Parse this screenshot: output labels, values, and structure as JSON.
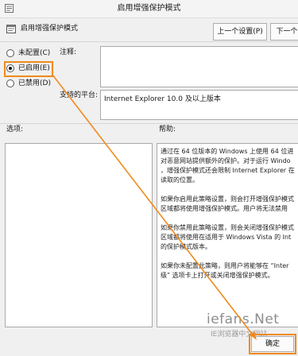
{
  "window": {
    "title": "启用增强保护模式"
  },
  "policy": {
    "name": "启用增强保护模式"
  },
  "nav": {
    "prev_label": "上一个设置(P)",
    "next_label": "下一个"
  },
  "options": [
    {
      "label": "未配置(C)",
      "selected": false
    },
    {
      "label": "已启用(E)",
      "selected": true
    },
    {
      "label": "已禁用(D)",
      "selected": false
    }
  ],
  "comment": {
    "label": "注释:",
    "value": ""
  },
  "platform": {
    "label": "支持的平台:",
    "value": "Internet Explorer 10.0 及以上版本"
  },
  "sections": {
    "options_label": "选项:",
    "help_label": "帮助:"
  },
  "help": {
    "paragraphs": [
      "通过在 64 位版本的 Windows 上使用 64 位进\n对恶意网站提供额外的保护。对于运行 Windo\n，增强保护模式还会限制 Internet Explorer 在\n读取的位置。",
      "如果你启用此策略设置，则会打开增强保护模式\n区域都将使用增强保护模式。用户将无法禁用",
      "如果你禁用此策略设置，则会关闭增强保护模式\n区域都将使用在适用于 Windows Vista 的 Int\n的保护模式版本。",
      "如果你未配置此策略，则用户将能够在 “Inter\n级” 选项卡上打开或关闭增强保护模式。"
    ]
  },
  "footer": {
    "ok_label": "确定"
  },
  "watermark": {
    "brand": "iefans.Net",
    "sub": "IE浏览器中文网站"
  },
  "colors": {
    "highlight": "#ef8a1e",
    "window_bg": "#f0f0f0"
  },
  "icons": {
    "window": "policy-window-icon",
    "policy": "policy-setting-icon"
  }
}
